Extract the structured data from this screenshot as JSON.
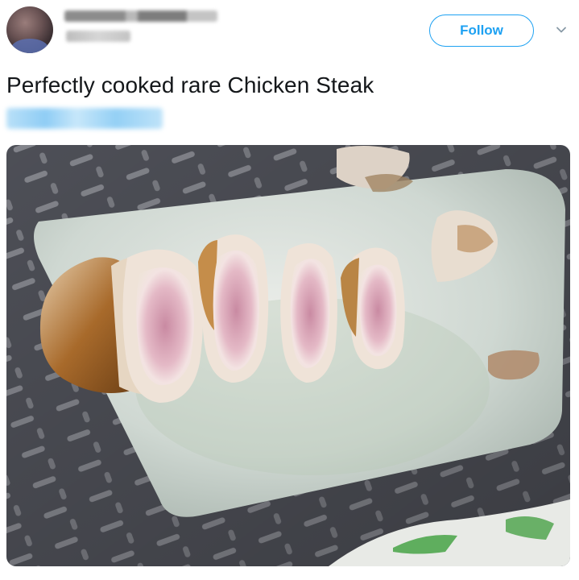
{
  "header": {
    "follow_label": "Follow"
  },
  "tweet": {
    "text": "Perfectly cooked rare Chicken Steak"
  },
  "icons": {
    "chevron": "chevron-down-icon"
  },
  "colors": {
    "accent": "#1da1f2",
    "text": "#14171a"
  }
}
